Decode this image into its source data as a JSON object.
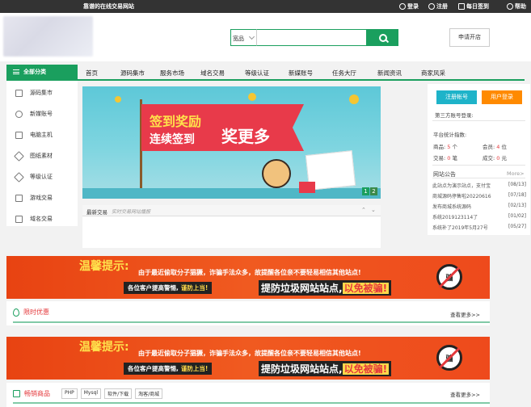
{
  "topbar": {
    "site_name": "靠谱的在线交易网站",
    "links": [
      {
        "label": "登录",
        "icon": "user-icon"
      },
      {
        "label": "注册",
        "icon": "user-add-icon"
      },
      {
        "label": "每日签到",
        "icon": "calendar-icon"
      },
      {
        "label": "帮助",
        "icon": "help-icon"
      }
    ]
  },
  "search": {
    "category": "宽品",
    "placeholder": "",
    "button_icon": "search-icon"
  },
  "header": {
    "apply_shop": "申请开店"
  },
  "categories": {
    "title": "全部分类",
    "items": [
      "源码集市",
      "新媒账号",
      "电脑主机",
      "图纸素材",
      "等级认证",
      "游戏交易",
      "域名交易"
    ]
  },
  "nav": [
    "首页",
    "源码集市",
    "服务市场",
    "域名交易",
    "等级认证",
    "新媒账号",
    "任务大厅",
    "新闻资讯",
    "商家风采"
  ],
  "banner": {
    "line1": "签到奖励",
    "line2": "连续签到",
    "line3": "奖更多",
    "pages": [
      "1",
      "2"
    ]
  },
  "latest_deals": {
    "title": "最新交易",
    "subtitle": "实时交易网站播报"
  },
  "account": {
    "register": "注册帐号",
    "login": "用户登录",
    "third_party": "第三方账号登录:"
  },
  "stats": {
    "title": "平台统计指数:",
    "rows": [
      {
        "label": "商品:",
        "value": "5",
        "unit": "个"
      },
      {
        "label": "会员:",
        "value": "4",
        "unit": "位"
      },
      {
        "label": "交易:",
        "value": "0",
        "unit": "笔"
      },
      {
        "label": "成交:",
        "value": "0",
        "unit": "元"
      }
    ]
  },
  "notices": {
    "title": "网站公告",
    "more": "More>",
    "items": [
      {
        "text": "此站点为演示站点，支付宝",
        "date": "[08/13]"
      },
      {
        "text": "商城源码停售啦20220616",
        "date": "[07/18]"
      },
      {
        "text": "发布商城系统源码",
        "date": "[02/13]"
      },
      {
        "text": "系统2019123114了",
        "date": "[01/02]"
      },
      {
        "text": "系统补了2019年5月27号",
        "date": "[05/27]"
      }
    ]
  },
  "warning": {
    "title": "温馨提示:",
    "line": "由于最近偷取分子猖獗，诈骗手法众多，故提醒各位亲不要轻易相信其他站点!",
    "pill_a": "各位客户提高警惕,",
    "pill_b": "谨防上当!",
    "big_a": "提防垃圾网站站点,",
    "big_b": "以免被骗!",
    "stamp": "骗"
  },
  "section_limited": {
    "title": "限时优惠",
    "more": "查看更多>>"
  },
  "section_hot": {
    "title": "畅销商品",
    "tags": [
      "PHP",
      "Mysql",
      "软件/下载",
      "淘客/商城"
    ],
    "more": "查看更多>>"
  }
}
